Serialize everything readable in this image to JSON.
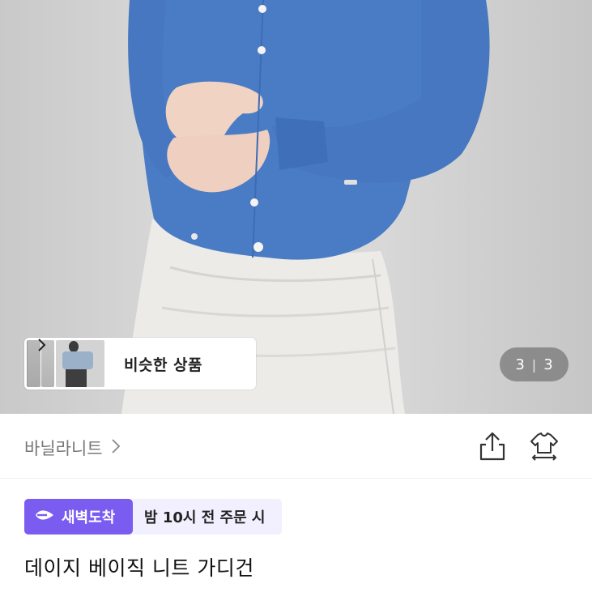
{
  "similar_products": {
    "label": "비슷한 상품",
    "chevron_icon": "chevron-right-icon"
  },
  "image_counter": {
    "current": "3",
    "separator": "|",
    "total": "3"
  },
  "brand": {
    "name": "바닐라니트",
    "chevron_icon": "chevron-right-icon"
  },
  "actions": {
    "share_icon": "share-icon",
    "outfit_icon": "outfit-swap-icon"
  },
  "delivery": {
    "badge_label": "새벽도착",
    "badge_icon": "dawn-delivery-icon",
    "time_text": "밤 10시 전 주문 시"
  },
  "product": {
    "title": "데이지 베이직 니트 가디건"
  },
  "colors": {
    "accent": "#7b5cf0",
    "accent_light": "#f2effe",
    "cardigan": "#4a7cc5",
    "skirt": "#eceae6"
  }
}
